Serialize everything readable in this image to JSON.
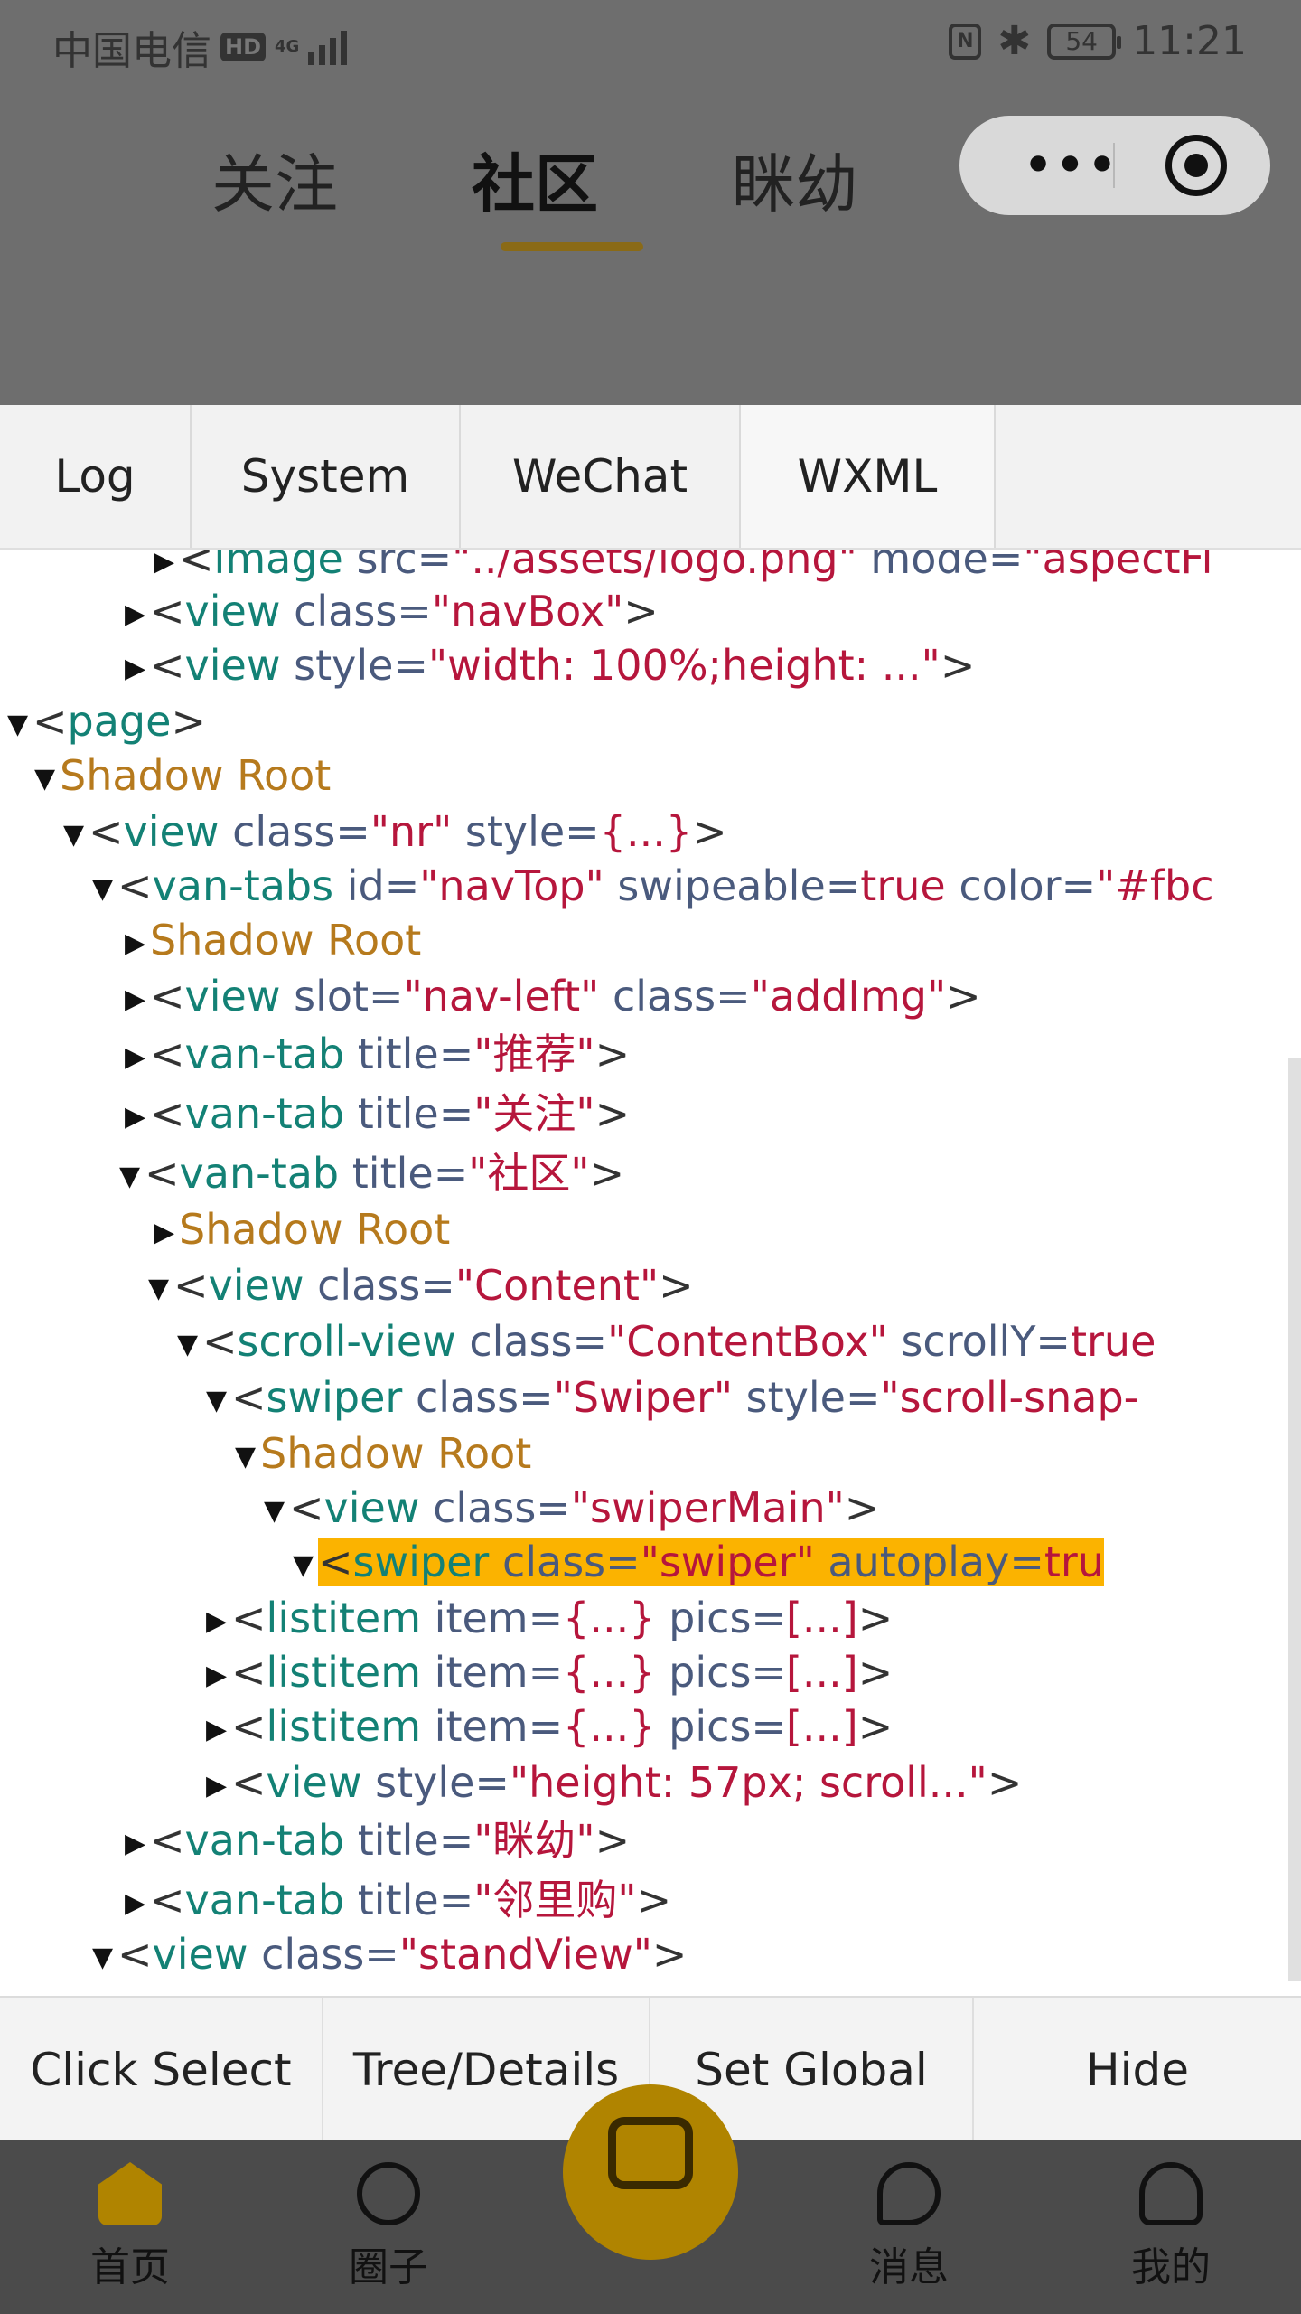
{
  "status_bar": {
    "carrier": "中国电信",
    "hd": "HD",
    "network": "4G",
    "battery": "54",
    "time": "11:21",
    "icons": [
      "signal-icon",
      "nfc-icon",
      "bluetooth-icon",
      "battery-icon"
    ]
  },
  "top_tabs": [
    {
      "label": "关注"
    },
    {
      "label": "社区"
    },
    {
      "label": "眯幼"
    }
  ],
  "debug_tabs": [
    "Log",
    "System",
    "WeChat",
    "WXML"
  ],
  "tree": {
    "rows": [
      {
        "indent": 170,
        "arrow": "▶",
        "tag": "image",
        "attrs": [
          {
            "name": "src",
            "value": "../assets/logo.png"
          },
          {
            "name": "mode",
            "value": "aspectFi"
          }
        ],
        "closing": ""
      },
      {
        "indent": 138,
        "arrow": "▶",
        "tag": "view",
        "attrs": [
          {
            "name": "class",
            "value": "navBox"
          }
        ],
        "closing": ">"
      },
      {
        "indent": 138,
        "arrow": "▶",
        "tag": "view",
        "attrs": [
          {
            "name": "style",
            "value": "width: 100%;height: ..."
          }
        ],
        "closing": ">"
      },
      {
        "indent": 8,
        "arrow": "▼",
        "tag": "page",
        "attrs": [],
        "closing": ">"
      },
      {
        "indent": 38,
        "arrow": "▼",
        "shadow": "Shadow Root"
      },
      {
        "indent": 70,
        "arrow": "▼",
        "tag": "view",
        "attrs": [
          {
            "name": "class",
            "value": "nr"
          },
          {
            "name": "style",
            "value": "{...}"
          }
        ],
        "closing": ">"
      },
      {
        "indent": 102,
        "arrow": "▼",
        "tag": "van-tabs",
        "attrs": [
          {
            "name": "id",
            "value": "navTop"
          },
          {
            "name": "swipeable",
            "value": "true"
          },
          {
            "name": "color",
            "value": "#fbc"
          }
        ],
        "closing": ""
      },
      {
        "indent": 138,
        "arrow": "▶",
        "shadow": "Shadow Root"
      },
      {
        "indent": 138,
        "arrow": "▶",
        "tag": "view",
        "attrs": [
          {
            "name": "slot",
            "value": "nav-left"
          },
          {
            "name": "class",
            "value": "addImg"
          }
        ],
        "closing": ">"
      },
      {
        "indent": 138,
        "arrow": "▶",
        "tag": "van-tab",
        "attrs": [
          {
            "name": "title",
            "value": "推荐"
          }
        ],
        "closing": ">"
      },
      {
        "indent": 138,
        "arrow": "▶",
        "tag": "van-tab",
        "attrs": [
          {
            "name": "title",
            "value": "关注"
          }
        ],
        "closing": ">"
      },
      {
        "indent": 132,
        "arrow": "▼",
        "tag": "van-tab",
        "attrs": [
          {
            "name": "title",
            "value": "社区"
          }
        ],
        "closing": ">"
      },
      {
        "indent": 170,
        "arrow": "▶",
        "shadow": "Shadow Root"
      },
      {
        "indent": 164,
        "arrow": "▼",
        "tag": "view",
        "attrs": [
          {
            "name": "class",
            "value": "Content"
          }
        ],
        "closing": ">"
      },
      {
        "indent": 196,
        "arrow": "▼",
        "tag": "scroll-view",
        "attrs": [
          {
            "name": "class",
            "value": "ContentBox"
          },
          {
            "name": "scrollY",
            "value": "true"
          }
        ],
        "closing": ""
      },
      {
        "indent": 228,
        "arrow": "▼",
        "tag": "swiper",
        "attrs": [
          {
            "name": "class",
            "value": "Swiper"
          },
          {
            "name": "style",
            "value": "scroll-snap-"
          }
        ],
        "closing": ""
      },
      {
        "indent": 260,
        "arrow": "▼",
        "shadow": "Shadow Root"
      },
      {
        "indent": 292,
        "arrow": "▼",
        "tag": "view",
        "attrs": [
          {
            "name": "class",
            "value": "swiperMain"
          }
        ],
        "closing": ">"
      },
      {
        "indent": 324,
        "arrow": "▼",
        "tag": "swiper",
        "attrs": [
          {
            "name": "class",
            "value": "swiper"
          },
          {
            "name": "autoplay",
            "value": "tru"
          }
        ],
        "closing": "",
        "highlight": true
      },
      {
        "indent": 228,
        "arrow": "▶",
        "tag": "listitem",
        "attrs": [
          {
            "name": "item",
            "value": "{...}"
          },
          {
            "name": "pics",
            "value": "[...]"
          }
        ],
        "closing": ">"
      },
      {
        "indent": 228,
        "arrow": "▶",
        "tag": "listitem",
        "attrs": [
          {
            "name": "item",
            "value": "{...}"
          },
          {
            "name": "pics",
            "value": "[...]"
          }
        ],
        "closing": ">"
      },
      {
        "indent": 228,
        "arrow": "▶",
        "tag": "listitem",
        "attrs": [
          {
            "name": "item",
            "value": "{...}"
          },
          {
            "name": "pics",
            "value": "[...]"
          }
        ],
        "closing": ">"
      },
      {
        "indent": 228,
        "arrow": "▶",
        "tag": "view",
        "attrs": [
          {
            "name": "style",
            "value": "height: 57px; scroll..."
          }
        ],
        "closing": ">"
      },
      {
        "indent": 138,
        "arrow": "▶",
        "tag": "van-tab",
        "attrs": [
          {
            "name": "title",
            "value": "眯幼"
          }
        ],
        "closing": ">"
      },
      {
        "indent": 138,
        "arrow": "▶",
        "tag": "van-tab",
        "attrs": [
          {
            "name": "title",
            "value": "邻里购"
          }
        ],
        "closing": ">"
      },
      {
        "indent": 102,
        "arrow": "▼",
        "tag": "view",
        "attrs": [
          {
            "name": "class",
            "value": "standView"
          }
        ],
        "closing": ">"
      }
    ]
  },
  "actions": [
    "Click Select",
    "Tree/Details",
    "Set Global",
    "Hide"
  ],
  "bottom_nav": [
    {
      "label": "首页",
      "icon": "home-icon"
    },
    {
      "label": "圈子",
      "icon": "circle-icon"
    },
    {
      "label": "消息",
      "icon": "message-icon"
    },
    {
      "label": "我的",
      "icon": "profile-icon"
    }
  ],
  "colors": {
    "accent": "#fbb300",
    "tag": "#138175",
    "attr": "#4a5a7d",
    "value": "#b6163c",
    "shadow": "#b67a1d"
  }
}
